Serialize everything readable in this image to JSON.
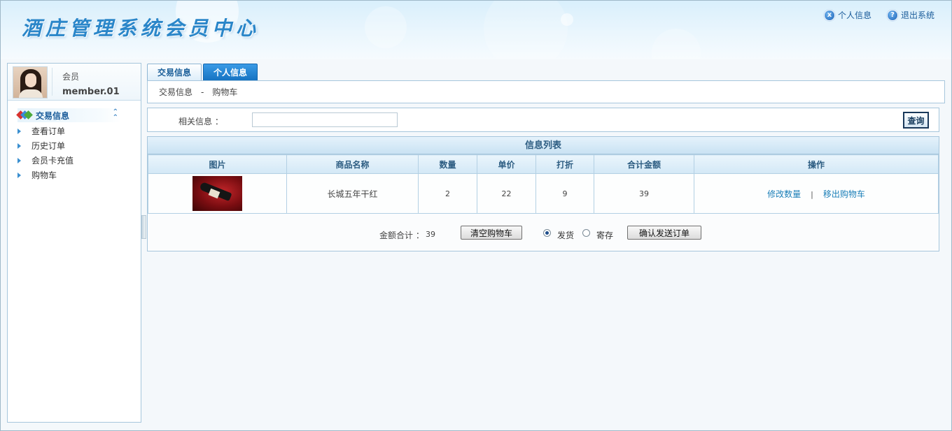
{
  "header": {
    "title": "酒庄管理系统会员中心",
    "links": [
      {
        "label": "个人信息",
        "icon": "x-circle-icon",
        "glyph": "x"
      },
      {
        "label": "退出系统",
        "icon": "help-circle-icon",
        "glyph": "?"
      }
    ]
  },
  "sidebar": {
    "user": {
      "role": "会员",
      "name": "member.01"
    },
    "section": {
      "label": "交易信息"
    },
    "items": [
      {
        "label": "查看订单"
      },
      {
        "label": "历史订单"
      },
      {
        "label": "会员卡充值"
      },
      {
        "label": "购物车"
      }
    ]
  },
  "tabs": [
    {
      "label": "交易信息",
      "active": false
    },
    {
      "label": "个人信息",
      "active": true
    }
  ],
  "breadcrumb": {
    "parent": "交易信息",
    "separator": "-",
    "current": "购物车"
  },
  "search": {
    "label": "相关信息 ：",
    "value": "",
    "button": "查询"
  },
  "list": {
    "title": "信息列表",
    "columns": [
      "图片",
      "商品名称",
      "数量",
      "单价",
      "打折",
      "合计金额",
      "操作"
    ],
    "rows": [
      {
        "product": "长城五年干红",
        "quantity": "2",
        "price": "22",
        "discount": "9",
        "total": "39",
        "actions": [
          "修改数量",
          "移出购物车"
        ],
        "action_sep": "|"
      }
    ],
    "summary": {
      "total_label": "金额合计 ：",
      "total_value": "39",
      "clear_button": "清空购物车",
      "options": [
        {
          "label": "发货",
          "checked": true
        },
        {
          "label": "寄存",
          "checked": false
        }
      ],
      "confirm_button": "确认发送订单"
    }
  },
  "colors": {
    "accent": "#1673c2",
    "border": "#a7c6dc",
    "link": "#1b7fb8"
  }
}
